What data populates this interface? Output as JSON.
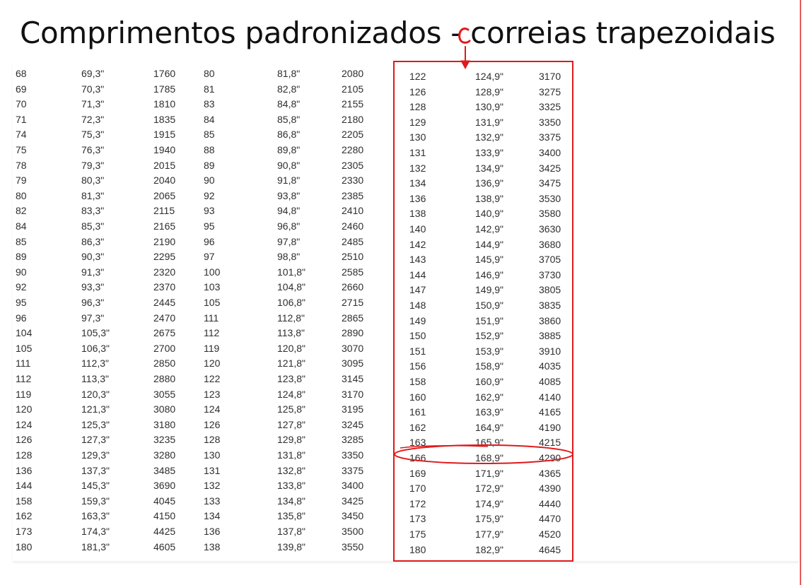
{
  "page": {
    "title": "Comprimentos padronizados - correias trapezoidais"
  },
  "annotation": {
    "letter": "C",
    "color": "#e0191b"
  },
  "table": {
    "column_groups": [
      {
        "rows": [
          [
            "68",
            "69,3\"",
            "1760"
          ],
          [
            "69",
            "70,3\"",
            "1785"
          ],
          [
            "70",
            "71,3\"",
            "1810"
          ],
          [
            "71",
            "72,3\"",
            "1835"
          ],
          [
            "74",
            "75,3\"",
            "1915"
          ],
          [
            "75",
            "76,3\"",
            "1940"
          ],
          [
            "78",
            "79,3\"",
            "2015"
          ],
          [
            "79",
            "80,3\"",
            "2040"
          ],
          [
            "80",
            "81,3\"",
            "2065"
          ],
          [
            "82",
            "83,3\"",
            "2115"
          ],
          [
            "84",
            "85,3\"",
            "2165"
          ],
          [
            "85",
            "86,3\"",
            "2190"
          ],
          [
            "89",
            "90,3\"",
            "2295"
          ],
          [
            "90",
            "91,3\"",
            "2320"
          ],
          [
            "92",
            "93,3\"",
            "2370"
          ],
          [
            "95",
            "96,3\"",
            "2445"
          ],
          [
            "96",
            "97,3\"",
            "2470"
          ],
          [
            "104",
            "105,3\"",
            "2675"
          ],
          [
            "105",
            "106,3\"",
            "2700"
          ],
          [
            "111",
            "112,3\"",
            "2850"
          ],
          [
            "112",
            "113,3\"",
            "2880"
          ],
          [
            "119",
            "120,3\"",
            "3055"
          ],
          [
            "120",
            "121,3\"",
            "3080"
          ],
          [
            "124",
            "125,3\"",
            "3180"
          ],
          [
            "126",
            "127,3\"",
            "3235"
          ],
          [
            "128",
            "129,3\"",
            "3280"
          ],
          [
            "136",
            "137,3\"",
            "3485"
          ],
          [
            "144",
            "145,3\"",
            "3690"
          ],
          [
            "158",
            "159,3\"",
            "4045"
          ],
          [
            "162",
            "163,3\"",
            "4150"
          ],
          [
            "173",
            "174,3\"",
            "4425"
          ],
          [
            "180",
            "181,3\"",
            "4605"
          ]
        ]
      },
      {
        "rows": [
          [
            "80",
            "81,8\"",
            "2080"
          ],
          [
            "81",
            "82,8\"",
            "2105"
          ],
          [
            "83",
            "84,8\"",
            "2155"
          ],
          [
            "84",
            "85,8\"",
            "2180"
          ],
          [
            "85",
            "86,8\"",
            "2205"
          ],
          [
            "88",
            "89,8\"",
            "2280"
          ],
          [
            "89",
            "90,8\"",
            "2305"
          ],
          [
            "90",
            "91,8\"",
            "2330"
          ],
          [
            "92",
            "93,8\"",
            "2385"
          ],
          [
            "93",
            "94,8\"",
            "2410"
          ],
          [
            "95",
            "96,8\"",
            "2460"
          ],
          [
            "96",
            "97,8\"",
            "2485"
          ],
          [
            "97",
            "98,8\"",
            "2510"
          ],
          [
            "100",
            "101,8\"",
            "2585"
          ],
          [
            "103",
            "104,8\"",
            "2660"
          ],
          [
            "105",
            "106,8\"",
            "2715"
          ],
          [
            "111",
            "112,8\"",
            "2865"
          ],
          [
            "112",
            "113,8\"",
            "2890"
          ],
          [
            "119",
            "120,8\"",
            "3070"
          ],
          [
            "120",
            "121,8\"",
            "3095"
          ],
          [
            "122",
            "123,8\"",
            "3145"
          ],
          [
            "123",
            "124,8\"",
            "3170"
          ],
          [
            "124",
            "125,8\"",
            "3195"
          ],
          [
            "126",
            "127,8\"",
            "3245"
          ],
          [
            "128",
            "129,8\"",
            "3285"
          ],
          [
            "130",
            "131,8\"",
            "3350"
          ],
          [
            "131",
            "132,8\"",
            "3375"
          ],
          [
            "132",
            "133,8\"",
            "3400"
          ],
          [
            "133",
            "134,8\"",
            "3425"
          ],
          [
            "134",
            "135,8\"",
            "3450"
          ],
          [
            "136",
            "137,8\"",
            "3500"
          ],
          [
            "138",
            "139,8\"",
            "3550"
          ]
        ]
      },
      {
        "rows": [
          [
            "122",
            "124,9\"",
            "3170"
          ],
          [
            "126",
            "128,9\"",
            "3275"
          ],
          [
            "128",
            "130,9\"",
            "3325"
          ],
          [
            "129",
            "131,9\"",
            "3350"
          ],
          [
            "130",
            "132,9\"",
            "3375"
          ],
          [
            "131",
            "133,9\"",
            "3400"
          ],
          [
            "132",
            "134,9\"",
            "3425"
          ],
          [
            "134",
            "136,9\"",
            "3475"
          ],
          [
            "136",
            "138,9\"",
            "3530"
          ],
          [
            "138",
            "140,9\"",
            "3580"
          ],
          [
            "140",
            "142,9\"",
            "3630"
          ],
          [
            "142",
            "144,9\"",
            "3680"
          ],
          [
            "143",
            "145,9\"",
            "3705"
          ],
          [
            "144",
            "146,9\"",
            "3730"
          ],
          [
            "147",
            "149,9\"",
            "3805"
          ],
          [
            "148",
            "150,9\"",
            "3835"
          ],
          [
            "149",
            "151,9\"",
            "3860"
          ],
          [
            "150",
            "152,9\"",
            "3885"
          ],
          [
            "151",
            "153,9\"",
            "3910"
          ],
          [
            "156",
            "158,9\"",
            "4035"
          ],
          [
            "158",
            "160,9\"",
            "4085"
          ],
          [
            "160",
            "162,9\"",
            "4140"
          ],
          [
            "161",
            "163,9\"",
            "4165"
          ],
          [
            "162",
            "164,9\"",
            "4190"
          ],
          [
            "163",
            "165,9\"",
            "4215"
          ],
          [
            "166",
            "168,9\"",
            "4290"
          ],
          [
            "169",
            "171,9\"",
            "4365"
          ],
          [
            "170",
            "172,9\"",
            "4390"
          ],
          [
            "172",
            "174,9\"",
            "4440"
          ],
          [
            "173",
            "175,9\"",
            "4470"
          ],
          [
            "175",
            "177,9\"",
            "4520"
          ],
          [
            "180",
            "182,9\"",
            "4645"
          ]
        ]
      }
    ]
  }
}
